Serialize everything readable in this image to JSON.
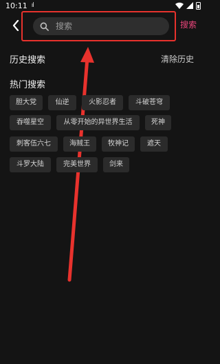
{
  "status_bar": {
    "time": "10:11",
    "signal_text": "ıl"
  },
  "header": {
    "search_placeholder": "搜索",
    "search_button_label": "搜索"
  },
  "history": {
    "title": "历史搜索",
    "clear_label": "清除历史"
  },
  "hot": {
    "title": "热门搜索",
    "tags": [
      "胆大党",
      "仙逆",
      "火影忍者",
      "斗破苍穹",
      "吞噬星空",
      "从零开始的异世界生活",
      "死神",
      "刺客伍六七",
      "海贼王",
      "牧神记",
      "遮天",
      "斗罗大陆",
      "完美世界",
      "剑来"
    ]
  },
  "annotation": {
    "color": "#e8322d"
  }
}
